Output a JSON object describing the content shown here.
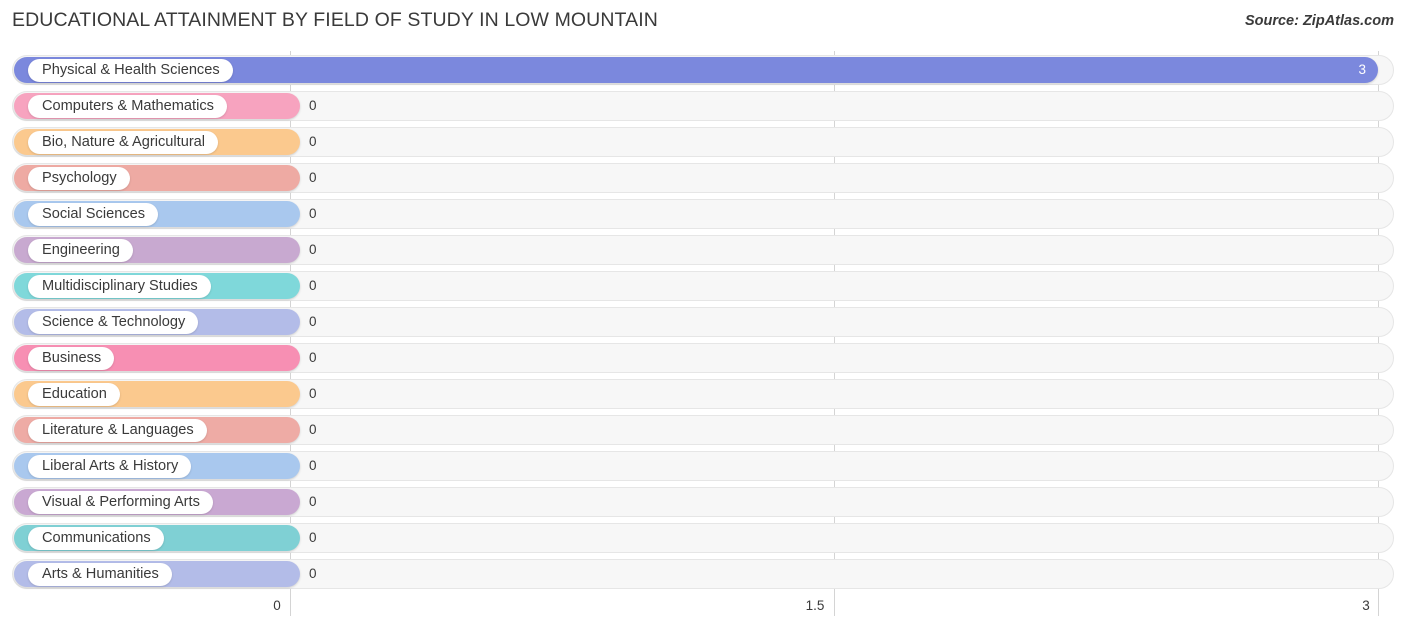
{
  "header": {
    "title": "EDUCATIONAL ATTAINMENT BY FIELD OF STUDY IN LOW MOUNTAIN",
    "source": "Source: ZipAtlas.com"
  },
  "chart_data": {
    "type": "bar",
    "orientation": "horizontal",
    "title": "EDUCATIONAL ATTAINMENT BY FIELD OF STUDY IN LOW MOUNTAIN",
    "xlabel": "",
    "ylabel": "",
    "xlim": [
      0,
      3
    ],
    "xticks": [
      "0",
      "1.5",
      "3"
    ],
    "xtick_values": [
      0,
      1.5,
      3
    ],
    "grid": true,
    "legend": false,
    "categories": [
      "Physical & Health Sciences",
      "Computers & Mathematics",
      "Bio, Nature & Agricultural",
      "Psychology",
      "Social Sciences",
      "Engineering",
      "Multidisciplinary Studies",
      "Science & Technology",
      "Business",
      "Education",
      "Literature & Languages",
      "Liberal Arts & History",
      "Visual & Performing Arts",
      "Communications",
      "Arts & Humanities"
    ],
    "values": [
      3,
      0,
      0,
      0,
      0,
      0,
      0,
      0,
      0,
      0,
      0,
      0,
      0,
      0,
      0
    ],
    "value_labels": [
      "3",
      "0",
      "0",
      "0",
      "0",
      "0",
      "0",
      "0",
      "0",
      "0",
      "0",
      "0",
      "0",
      "0",
      "0"
    ],
    "colors": [
      "#7b88dd",
      "#f7a3bf",
      "#fbc98e",
      "#eeaaa3",
      "#a9c8ee",
      "#c8a9d0",
      "#7fd8da",
      "#b3bce8",
      "#f78fb3",
      "#fbc98e",
      "#eeaba5",
      "#a9c8ee",
      "#c9a8d2",
      "#7fd0d4",
      "#b3bce8"
    ]
  },
  "axis": {
    "ticks": [
      {
        "label": "0",
        "x": 277
      },
      {
        "label": "1.5",
        "x": 815
      },
      {
        "label": "3",
        "x": 1366
      }
    ]
  }
}
